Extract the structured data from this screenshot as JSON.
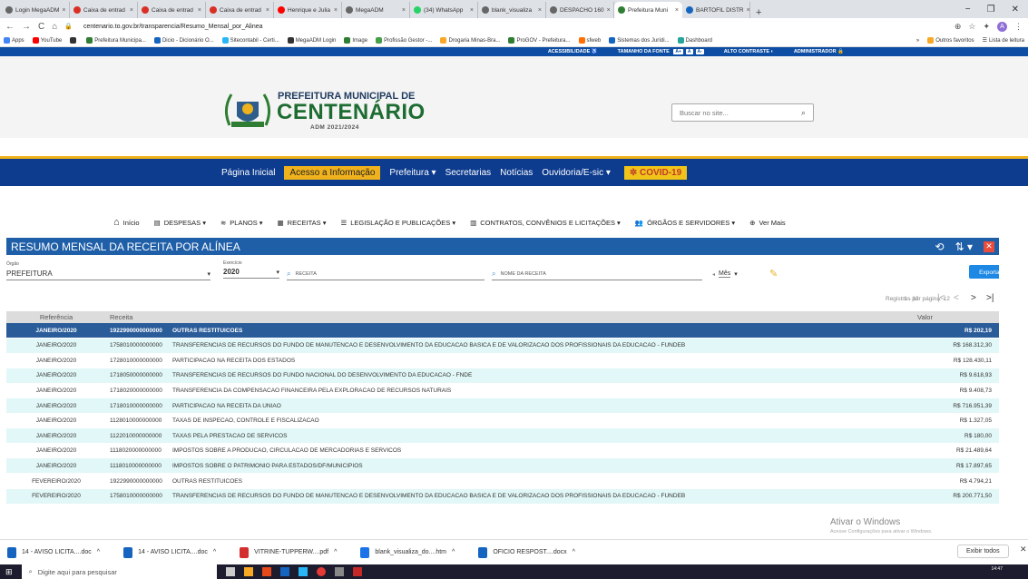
{
  "browser": {
    "tabs": [
      {
        "title": "Login MegaADM",
        "color": "#666"
      },
      {
        "title": "Caixa de entrad",
        "color": "#d93025"
      },
      {
        "title": "Caixa de entrad",
        "color": "#d93025"
      },
      {
        "title": "Caixa de entrad",
        "color": "#d93025"
      },
      {
        "title": "Henrique e Julia",
        "color": "#ff0000"
      },
      {
        "title": "MegaADM",
        "color": "#666"
      },
      {
        "title": "(34) WhatsApp",
        "color": "#25d366"
      },
      {
        "title": "blank_visualiza",
        "color": "#666"
      },
      {
        "title": "DESPACHO 160",
        "color": "#666"
      },
      {
        "title": "Prefeitura Muni",
        "color": "#2e7d32",
        "active": true
      },
      {
        "title": "BARTOFIL DISTR",
        "color": "#1565c0"
      }
    ],
    "url": "centenario.to.gov.br/transparencia/Resumo_Mensal_por_Alinea",
    "profile_initial": "A",
    "bookmarks": [
      {
        "label": "Apps",
        "color": "#4285f4"
      },
      {
        "label": "YouTube",
        "color": "#ff0000"
      },
      {
        "label": "",
        "color": "#333"
      },
      {
        "label": "Prefeitura Municipa...",
        "color": "#2e7d32"
      },
      {
        "label": "Dicio - Dicionário O...",
        "color": "#1565c0"
      },
      {
        "label": "Sitecontabil - Certi...",
        "color": "#29b6f6"
      },
      {
        "label": "MegaADM Login",
        "color": "#333"
      },
      {
        "label": "Image",
        "color": "#2e7d32"
      },
      {
        "label": "Profissão Gestor -...",
        "color": "#43a047"
      },
      {
        "label": "Drogaria Minas-Bra...",
        "color": "#f9a825"
      },
      {
        "label": "ProGOV - Prefeitura...",
        "color": "#2e7d32"
      },
      {
        "label": "sfweb",
        "color": "#ff6f00"
      },
      {
        "label": "Sistemas dos Jurídi...",
        "color": "#1565c0"
      },
      {
        "label": "Dashboard",
        "color": "#26a69a"
      }
    ],
    "bookmarks_more": "»",
    "other_favorites": "Outros favoritos",
    "reading_list": "Lista de leitura"
  },
  "accessibility": {
    "acessibilidade": "ACESSIBILIDADE",
    "font_size": "TAMANHO DA FONTE",
    "font_buttons": [
      "A+",
      "A",
      "A-"
    ],
    "contrast": "ALTO CONTRASTE",
    "admin": "ADMINISTRADOR"
  },
  "header": {
    "title_top": "PREFEITURA MUNICIPAL DE",
    "title_name": "CENTENÁRIO",
    "subtitle": "ADM 2021/2024",
    "search_placeholder": "Buscar no site..."
  },
  "mainnav": {
    "items": [
      "Página Inicial",
      "Acesso a Informação",
      "Prefeitura ▾",
      "Secretarias",
      "Notícias",
      "Ouvidoria/E-sic ▾"
    ],
    "covid": "✲ COVID-19"
  },
  "subnav": {
    "items": [
      "Início",
      "DESPESAS ▾",
      "PLANOS ▾",
      "RECEITAS ▾",
      "LEGISLAÇÃO E PUBLICAÇÕES ▾",
      "CONTRATOS, CONVÊNIOS E LICITAÇÕES ▾",
      "ÓRGÃOS E SERVIDORES ▾",
      "Ver Mais"
    ]
  },
  "panel": {
    "title": "RESUMO MENSAL DA RECEITA POR ALÍNEA",
    "orgao_label": "Órgão",
    "orgao_value": "PREFEITURA",
    "exercicio_label": "Exercício",
    "exercicio_value": "2020",
    "receita_placeholder": "RECEITA",
    "nome_placeholder": "NOME DA RECEITA",
    "mes_label": "Mês",
    "export_label": "Exportar ▾",
    "per_page_label": "Registros por página: 12",
    "range": "1 - 12",
    "col_ref": "Referência",
    "col_receita": "Receita",
    "col_valor": "Valor"
  },
  "rows": [
    {
      "ref": "JANEIRO/2020",
      "code": "1922990000000000",
      "name": "OUTRAS RESTITUICOES",
      "valor": "R$ 202,19",
      "sel": true
    },
    {
      "ref": "JANEIRO/2020",
      "code": "1758010000000000",
      "name": "TRANSFERENCIAS DE RECURSOS DO FUNDO DE MANUTENCAO E DESENVOLVIMENTO DA EDUCACAO BASICA E DE VALORIZACAO DOS PROFISSIONAIS DA EDUCACAO - FUNDEB",
      "valor": "R$ 168.312,30"
    },
    {
      "ref": "JANEIRO/2020",
      "code": "1728010000000000",
      "name": "PARTICIPACAO NA RECEITA DOS ESTADOS",
      "valor": "R$ 128.430,11"
    },
    {
      "ref": "JANEIRO/2020",
      "code": "1718050000000000",
      "name": "TRANSFERENCIAS DE RECURSOS DO FUNDO NACIONAL DO DESENVOLVIMENTO DA EDUCACAO - FNDE",
      "valor": "R$ 9.618,93"
    },
    {
      "ref": "JANEIRO/2020",
      "code": "1718020000000000",
      "name": "TRANSFERENCIA DA COMPENSACAO FINANCEIRA PELA EXPLORACAO DE RECURSOS NATURAIS",
      "valor": "R$ 9.408,73"
    },
    {
      "ref": "JANEIRO/2020",
      "code": "1718010000000000",
      "name": "PARTICIPACAO NA RECEITA DA UNIAO",
      "valor": "R$ 716.951,39"
    },
    {
      "ref": "JANEIRO/2020",
      "code": "1128010000000000",
      "name": "TAXAS DE INSPECAO, CONTROLE E FISCALIZACAO",
      "valor": "R$ 1.327,05"
    },
    {
      "ref": "JANEIRO/2020",
      "code": "1122010000000000",
      "name": "TAXAS PELA PRESTACAO DE SERVICOS",
      "valor": "R$ 180,00"
    },
    {
      "ref": "JANEIRO/2020",
      "code": "1118020000000000",
      "name": "IMPOSTOS SOBRE A PRODUCAO, CIRCULACAO DE MERCADORIAS E SERVICOS",
      "valor": "R$ 21.489,64"
    },
    {
      "ref": "JANEIRO/2020",
      "code": "1118010000000000",
      "name": "IMPOSTOS SOBRE O PATRIMONIO PARA ESTADOS/DF/MUNICIPIOS",
      "valor": "R$ 17.897,65"
    },
    {
      "ref": "FEVEREIRO/2020",
      "code": "1922990000000000",
      "name": "OUTRAS RESTITUICOES",
      "valor": "R$ 4.794,21"
    },
    {
      "ref": "FEVEREIRO/2020",
      "code": "1758010000000000",
      "name": "TRANSFERENCIAS DE RECURSOS DO FUNDO DE MANUTENCAO E DESENVOLVIMENTO DA EDUCACAO BASICA E DE VALORIZACAO DOS PROFISSIONAIS DA EDUCACAO - FUNDEB",
      "valor": "R$ 200.771,50"
    }
  ],
  "watermark": {
    "title": "Ativar o Windows",
    "sub": "Acesse Configurações para ativar o Windows."
  },
  "downloads": [
    {
      "label": "14 - AVISO LICITA....doc",
      "color": "#1565c0"
    },
    {
      "label": "14 - AVISO LICITA....doc",
      "color": "#1565c0"
    },
    {
      "label": "VITRINE-TUPPERW....pdf",
      "color": "#d32f2f"
    },
    {
      "label": "blank_visualiza_do....htm",
      "color": "#1a73e8"
    },
    {
      "label": "OFICIO RESPOST....docx",
      "color": "#1565c0"
    }
  ],
  "show_all": "Exibir todos",
  "taskbar": {
    "search_placeholder": "Digite aqui para pesquisar",
    "time": "14:47"
  }
}
